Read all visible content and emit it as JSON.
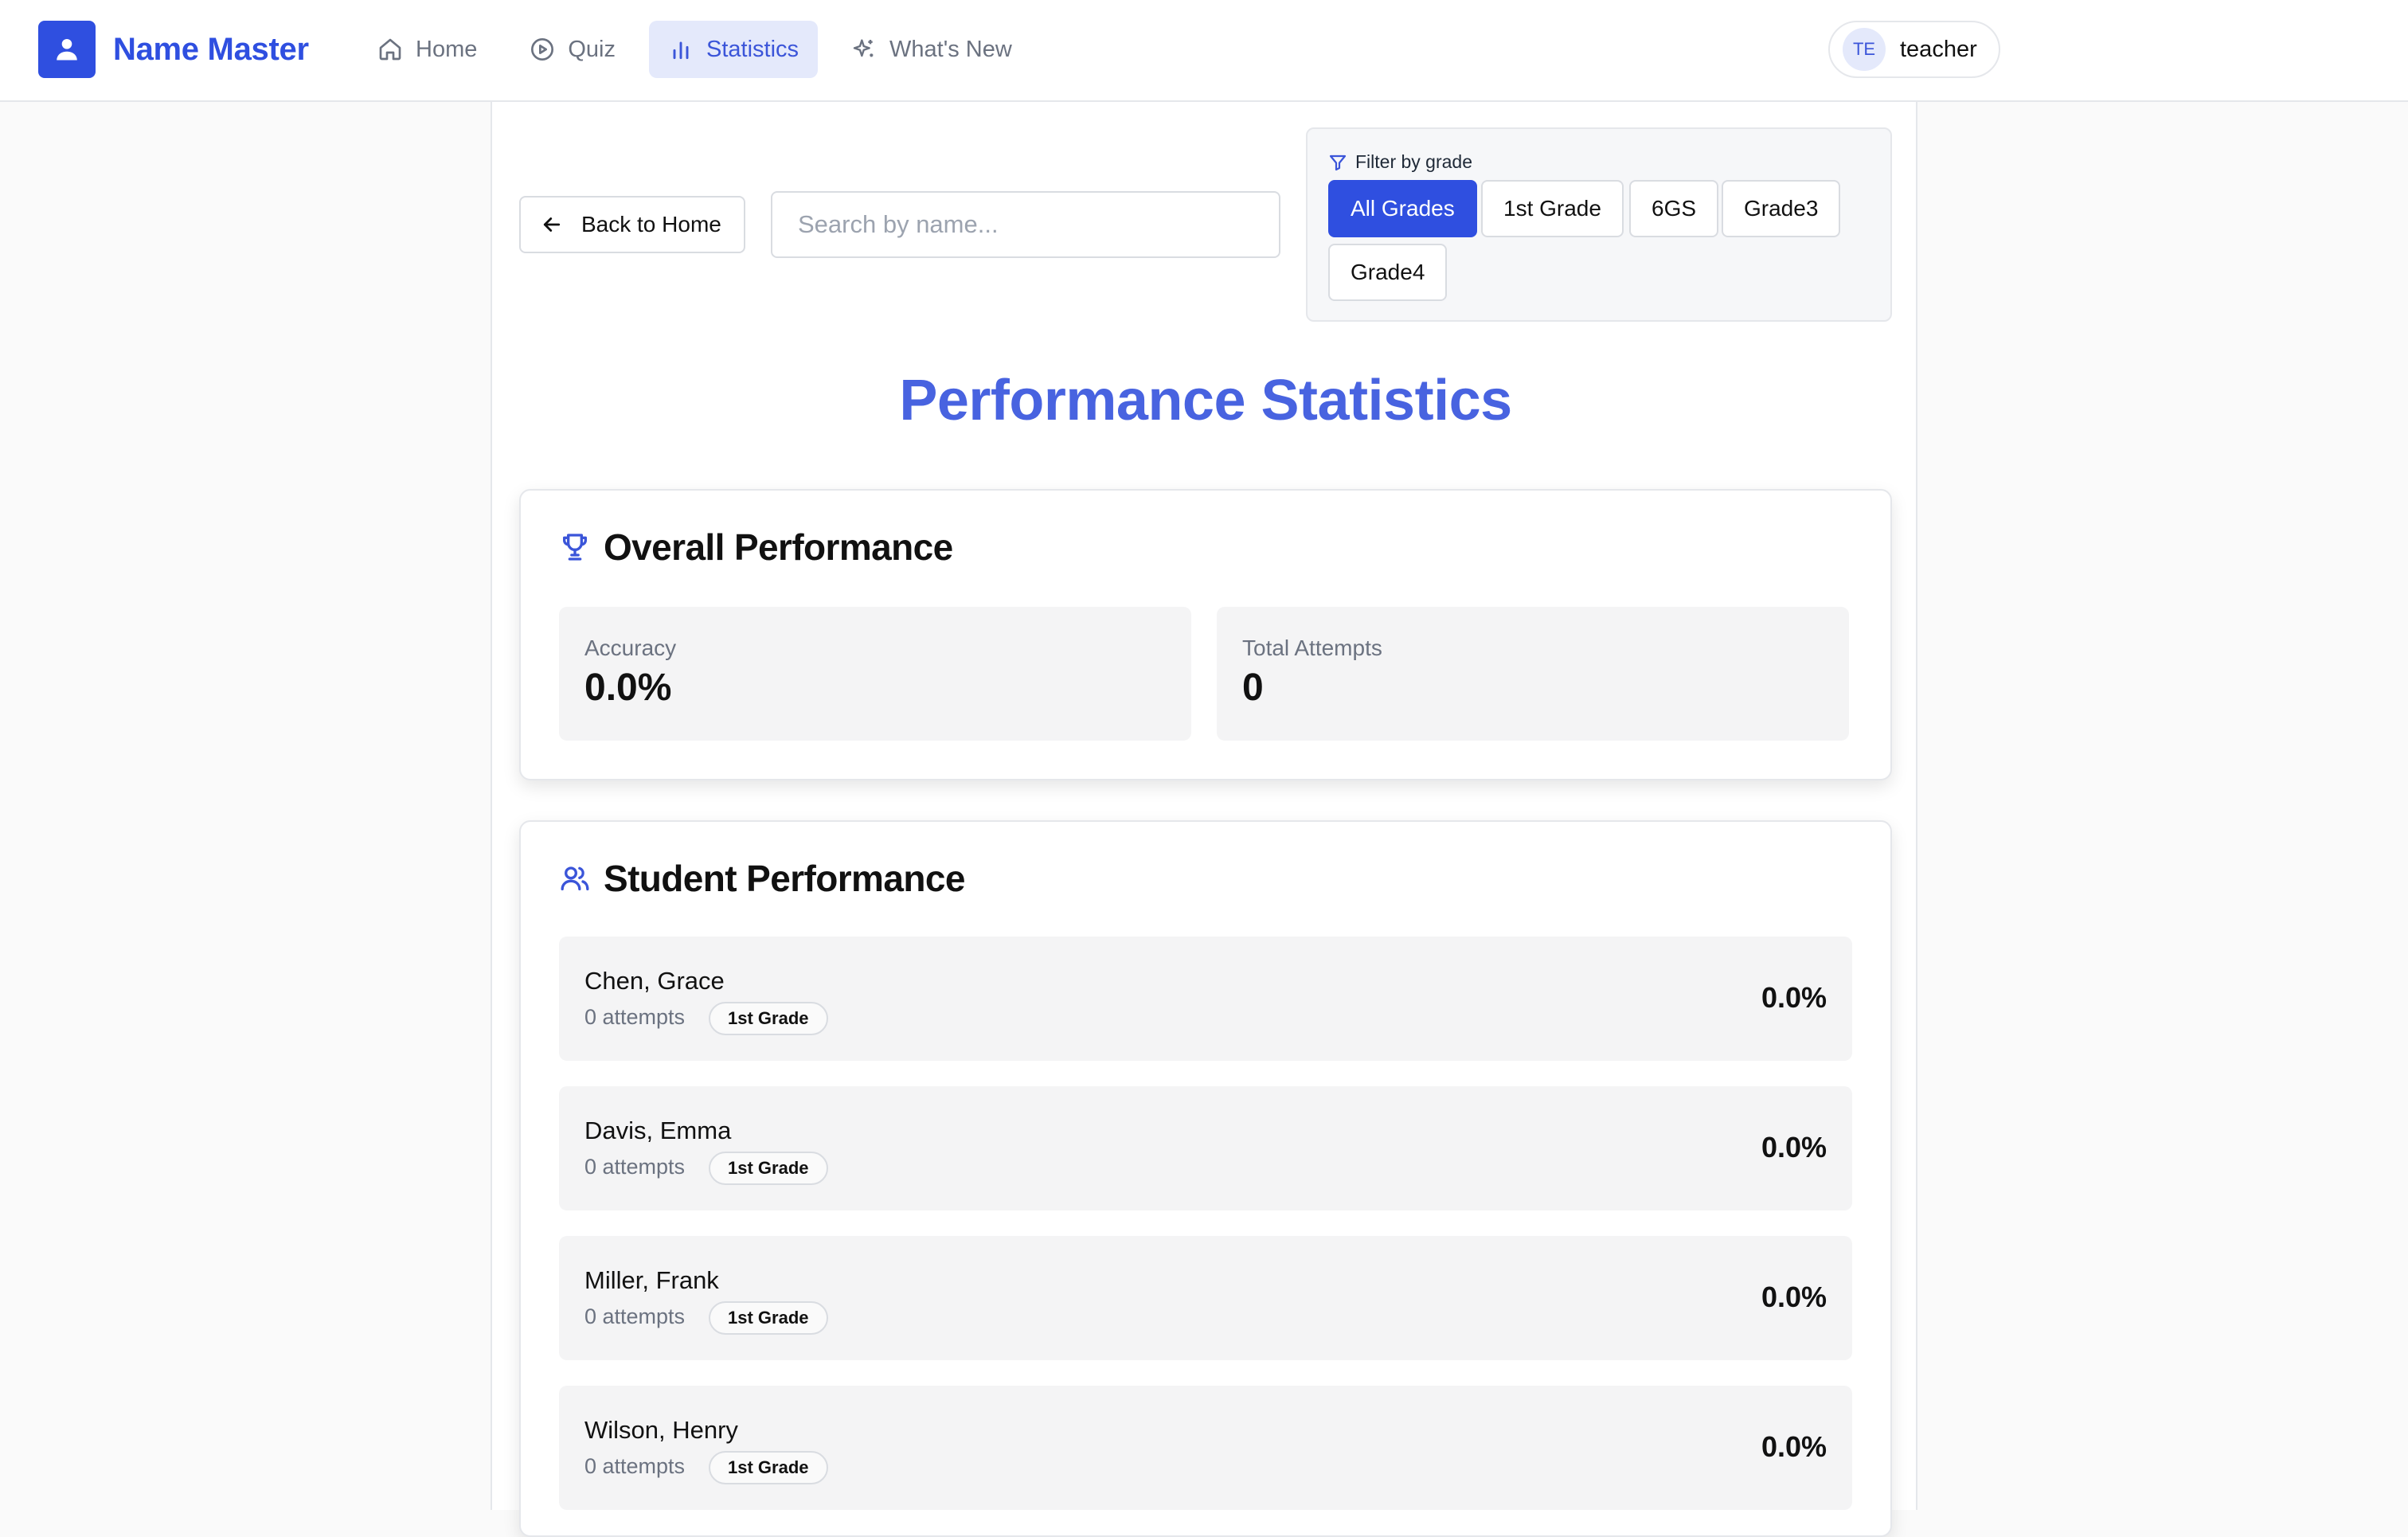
{
  "app": {
    "name": "Name Master"
  },
  "nav": {
    "items": [
      {
        "label": "Home",
        "icon": "home-icon",
        "active": false
      },
      {
        "label": "Quiz",
        "icon": "play-circle-icon",
        "active": false
      },
      {
        "label": "Statistics",
        "icon": "bar-chart-icon",
        "active": true
      },
      {
        "label": "What's New",
        "icon": "sparkles-icon",
        "active": false
      }
    ]
  },
  "user": {
    "initials": "TE",
    "name": "teacher"
  },
  "toolbar": {
    "back_label": "Back to Home",
    "search_placeholder": "Search by name...",
    "search_value": ""
  },
  "filter": {
    "label": "Filter by grade",
    "grades": [
      "All Grades",
      "1st Grade",
      "6GS",
      "Grade3",
      "Grade4"
    ],
    "selected": "All Grades"
  },
  "page": {
    "title": "Performance Statistics"
  },
  "overall": {
    "title": "Overall Performance",
    "accuracy_label": "Accuracy",
    "accuracy_value": "0.0%",
    "attempts_label": "Total Attempts",
    "attempts_value": "0"
  },
  "students": {
    "title": "Student Performance",
    "rows": [
      {
        "name": "Chen, Grace",
        "attempts": "0 attempts",
        "grade": "1st Grade",
        "score": "0.0%"
      },
      {
        "name": "Davis, Emma",
        "attempts": "0 attempts",
        "grade": "1st Grade",
        "score": "0.0%"
      },
      {
        "name": "Miller, Frank",
        "attempts": "0 attempts",
        "grade": "1st Grade",
        "score": "0.0%"
      },
      {
        "name": "Wilson, Henry",
        "attempts": "0 attempts",
        "grade": "1st Grade",
        "score": "0.0%"
      }
    ]
  },
  "colors": {
    "accent": "#2f4fe0",
    "title": "#4863e0",
    "nav_active_bg": "#e4e9fb"
  }
}
